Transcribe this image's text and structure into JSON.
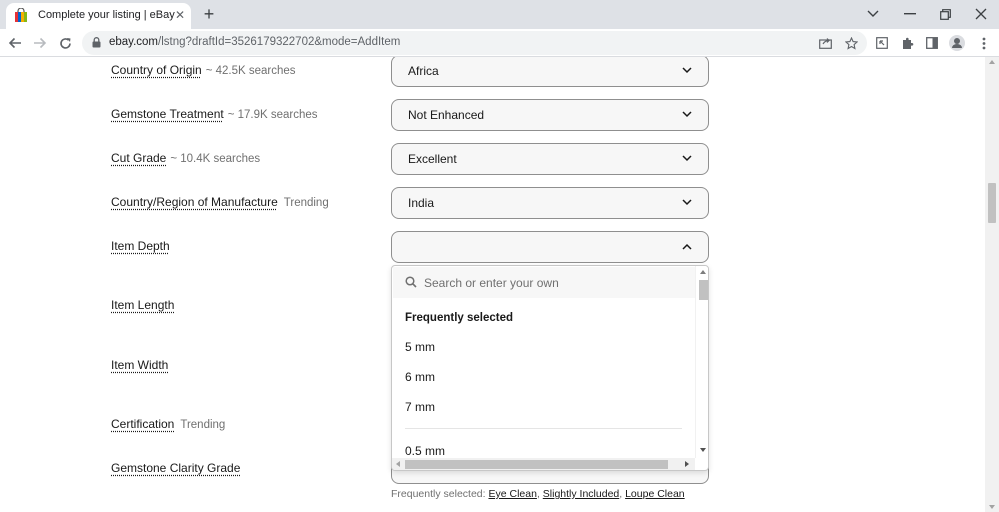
{
  "browser": {
    "tab_title": "Complete your listing | eBay",
    "url_host": "ebay.com",
    "url_path": "/lstng?draftId=3526179322702&mode=AddItem"
  },
  "form": {
    "rows": [
      {
        "label": "Country of Origin",
        "hint": "~ 42.5K searches",
        "value": "Africa"
      },
      {
        "label": "Gemstone Treatment",
        "hint": "~ 17.9K searches",
        "value": "Not Enhanced"
      },
      {
        "label": "Cut Grade",
        "hint": "~ 10.4K searches",
        "value": "Excellent"
      },
      {
        "label": "Country/Region of Manufacture",
        "hint": "Trending",
        "value": "India"
      },
      {
        "label": "Item Depth",
        "hint": "",
        "value": ""
      },
      {
        "label": "Item Length",
        "hint": ""
      },
      {
        "label": "Item Width",
        "hint": ""
      },
      {
        "label": "Certification",
        "hint": "Trending"
      },
      {
        "label": "Gemstone Clarity Grade",
        "hint": ""
      }
    ]
  },
  "dropdown": {
    "search_placeholder": "Search or enter your own",
    "heading": "Frequently selected",
    "options": [
      "5 mm",
      "6 mm",
      "7 mm",
      "0.5 mm"
    ]
  },
  "clarity": {
    "frequently_label": "Frequently selected:",
    "suggestions": [
      "Eye Clean",
      "Slightly Included",
      "Loupe Clean"
    ]
  },
  "icons": {
    "favicon": "ebay-shopping-bag-icon",
    "lock": "lock-icon",
    "search": "search-icon",
    "chevron_down": "chevron-down-icon",
    "chevron_up": "chevron-up-icon"
  },
  "colors": {
    "chrome_bg": "#dee1e6",
    "select_bg": "#f7f7f7",
    "select_border": "#8f8f8f",
    "hint_text": "#707070"
  }
}
